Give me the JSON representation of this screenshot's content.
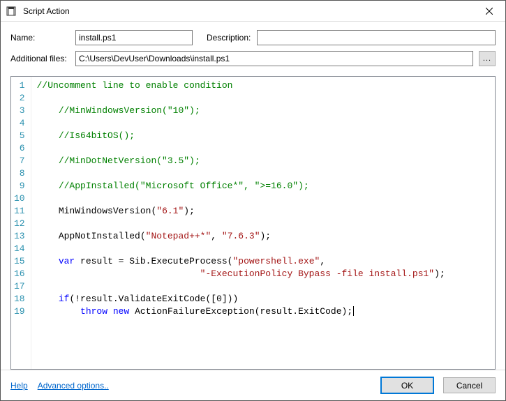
{
  "window": {
    "title": "Script Action"
  },
  "form": {
    "name_label": "Name:",
    "name_value": "install.ps1",
    "description_label": "Description:",
    "description_value": "",
    "files_label": "Additional files:",
    "files_value": "C:\\Users\\DevUser\\Downloads\\install.ps1",
    "browse_label": "..."
  },
  "code": {
    "lines": [
      [
        {
          "t": "comment",
          "s": "//Uncomment line to enable condition"
        }
      ],
      [],
      [
        {
          "t": "plain",
          "s": "    "
        },
        {
          "t": "comment",
          "s": "//MinWindowsVersion(\"10\");"
        }
      ],
      [],
      [
        {
          "t": "plain",
          "s": "    "
        },
        {
          "t": "comment",
          "s": "//Is64bitOS();"
        }
      ],
      [],
      [
        {
          "t": "plain",
          "s": "    "
        },
        {
          "t": "comment",
          "s": "//MinDotNetVersion(\"3.5\");"
        }
      ],
      [],
      [
        {
          "t": "plain",
          "s": "    "
        },
        {
          "t": "comment",
          "s": "//AppInstalled(\"Microsoft Office*\", \">=16.0\");"
        }
      ],
      [],
      [
        {
          "t": "plain",
          "s": "    "
        },
        {
          "t": "ident",
          "s": "MinWindowsVersion("
        },
        {
          "t": "string",
          "s": "\"6.1\""
        },
        {
          "t": "ident",
          "s": ");"
        }
      ],
      [],
      [
        {
          "t": "plain",
          "s": "    "
        },
        {
          "t": "ident",
          "s": "AppNotInstalled("
        },
        {
          "t": "string",
          "s": "\"Notepad++*\""
        },
        {
          "t": "ident",
          "s": ", "
        },
        {
          "t": "string",
          "s": "\"7.6.3\""
        },
        {
          "t": "ident",
          "s": ");"
        }
      ],
      [],
      [
        {
          "t": "plain",
          "s": "    "
        },
        {
          "t": "keyword",
          "s": "var"
        },
        {
          "t": "ident",
          "s": " result = Sib.ExecuteProcess("
        },
        {
          "t": "string",
          "s": "\"powershell.exe\""
        },
        {
          "t": "ident",
          "s": ","
        }
      ],
      [
        {
          "t": "plain",
          "s": "                              "
        },
        {
          "t": "string",
          "s": "\"-ExecutionPolicy Bypass -file install.ps1\""
        },
        {
          "t": "ident",
          "s": ");"
        }
      ],
      [],
      [
        {
          "t": "plain",
          "s": "    "
        },
        {
          "t": "keyword",
          "s": "if"
        },
        {
          "t": "ident",
          "s": "(!result.ValidateExitCode([0]))"
        }
      ],
      [
        {
          "t": "plain",
          "s": "        "
        },
        {
          "t": "keyword",
          "s": "throw"
        },
        {
          "t": "ident",
          "s": " "
        },
        {
          "t": "keyword",
          "s": "new"
        },
        {
          "t": "ident",
          "s": " ActionFailureException(result.ExitCode);"
        },
        {
          "t": "caret",
          "s": ""
        }
      ]
    ]
  },
  "footer": {
    "help": "Help",
    "advanced": "Advanced options..",
    "ok": "OK",
    "cancel": "Cancel"
  }
}
